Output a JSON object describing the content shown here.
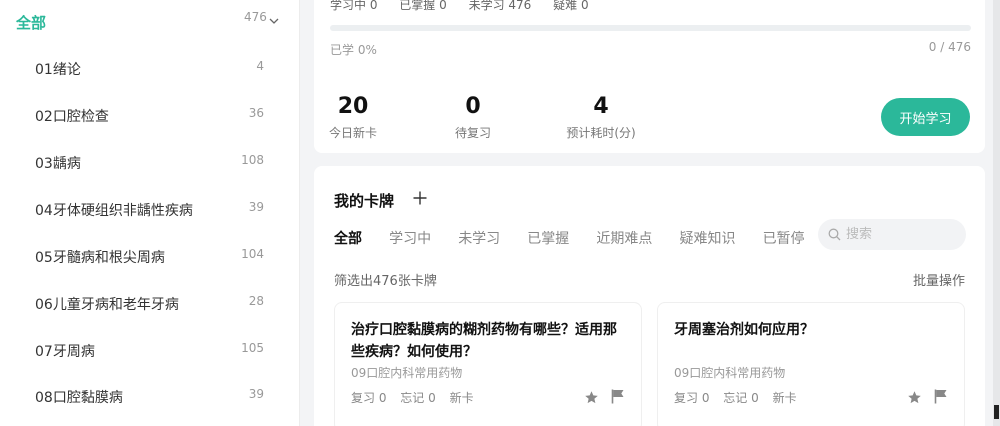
{
  "sidebar": {
    "all": {
      "label": "全部",
      "count": "476"
    },
    "items": [
      {
        "label": "01绪论",
        "count": "4"
      },
      {
        "label": "02口腔检查",
        "count": "36"
      },
      {
        "label": "03龋病",
        "count": "108"
      },
      {
        "label": "04牙体硬组织非龋性疾病",
        "count": "39"
      },
      {
        "label": "05牙髓病和根尖周病",
        "count": "104"
      },
      {
        "label": "06儿童牙病和老年牙病",
        "count": "28"
      },
      {
        "label": "07牙周病",
        "count": "105"
      },
      {
        "label": "08口腔黏膜病",
        "count": "39"
      }
    ]
  },
  "stats": {
    "status": {
      "learning": "学习中 0",
      "mastered": "已掌握 0",
      "unlearned": "未学习 476",
      "hard": "疑难 0"
    },
    "progress": {
      "fraction": 0,
      "left_label": "已学 0%",
      "right_label": "0 / 476"
    },
    "metrics": [
      {
        "value": "20",
        "label": "今日新卡"
      },
      {
        "value": "0",
        "label": "待复习"
      },
      {
        "value": "4",
        "label": "预计耗时(分)"
      }
    ],
    "start_button": "开始学习"
  },
  "cards_panel": {
    "title": "我的卡牌",
    "tabs": [
      "全部",
      "学习中",
      "未学习",
      "已掌握",
      "近期难点",
      "疑难知识",
      "已暂停"
    ],
    "search_placeholder": "搜索",
    "filter_summary": "筛选出476张卡牌",
    "batch_action": "批量操作",
    "cards": [
      {
        "question": "治疗口腔黏膜病的糊剂药物有哪些？适用那些疾病？如何使用？",
        "category": "09口腔内科常用药物",
        "review": "复习 0",
        "forget": "忘记 0",
        "status": "新卡"
      },
      {
        "question": "牙周塞治剂如何应用？",
        "category": "09口腔内科常用药物",
        "review": "复习 0",
        "forget": "忘记 0",
        "status": "新卡"
      }
    ]
  },
  "colors": {
    "accent": "#2bb89a",
    "background": "#f3f4f6",
    "icon_gray": "#888888"
  }
}
